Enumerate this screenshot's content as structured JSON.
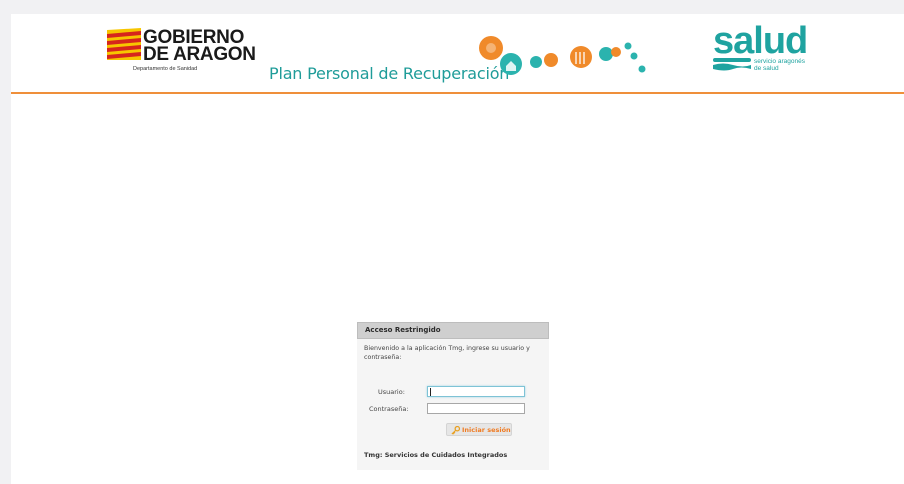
{
  "header": {
    "gobierno_line1": "GOBIERNO",
    "gobierno_line2": "DE ARAGON",
    "gobierno_dept": "Departamento de Sanidad",
    "plan_title": "Plan Personal de Recuperación",
    "salud_word": "salud",
    "salud_sub1": "servicio aragonés",
    "salud_sub2": "de salud",
    "accent_color": "#ef8f3a",
    "brand_teal": "#1fa3a0"
  },
  "login": {
    "title": "Acceso Restringido",
    "welcome": "Bienvenido a la aplicación Tmg, ingrese su usuario y contraseña:",
    "username_label": "Usuario:",
    "username_value": "",
    "password_label": "Contraseña:",
    "password_value": "",
    "submit_label": "Iniciar sesión",
    "submit_icon": "key-icon",
    "footer": "Tmg: Servicios de Cuidados Integrados"
  }
}
